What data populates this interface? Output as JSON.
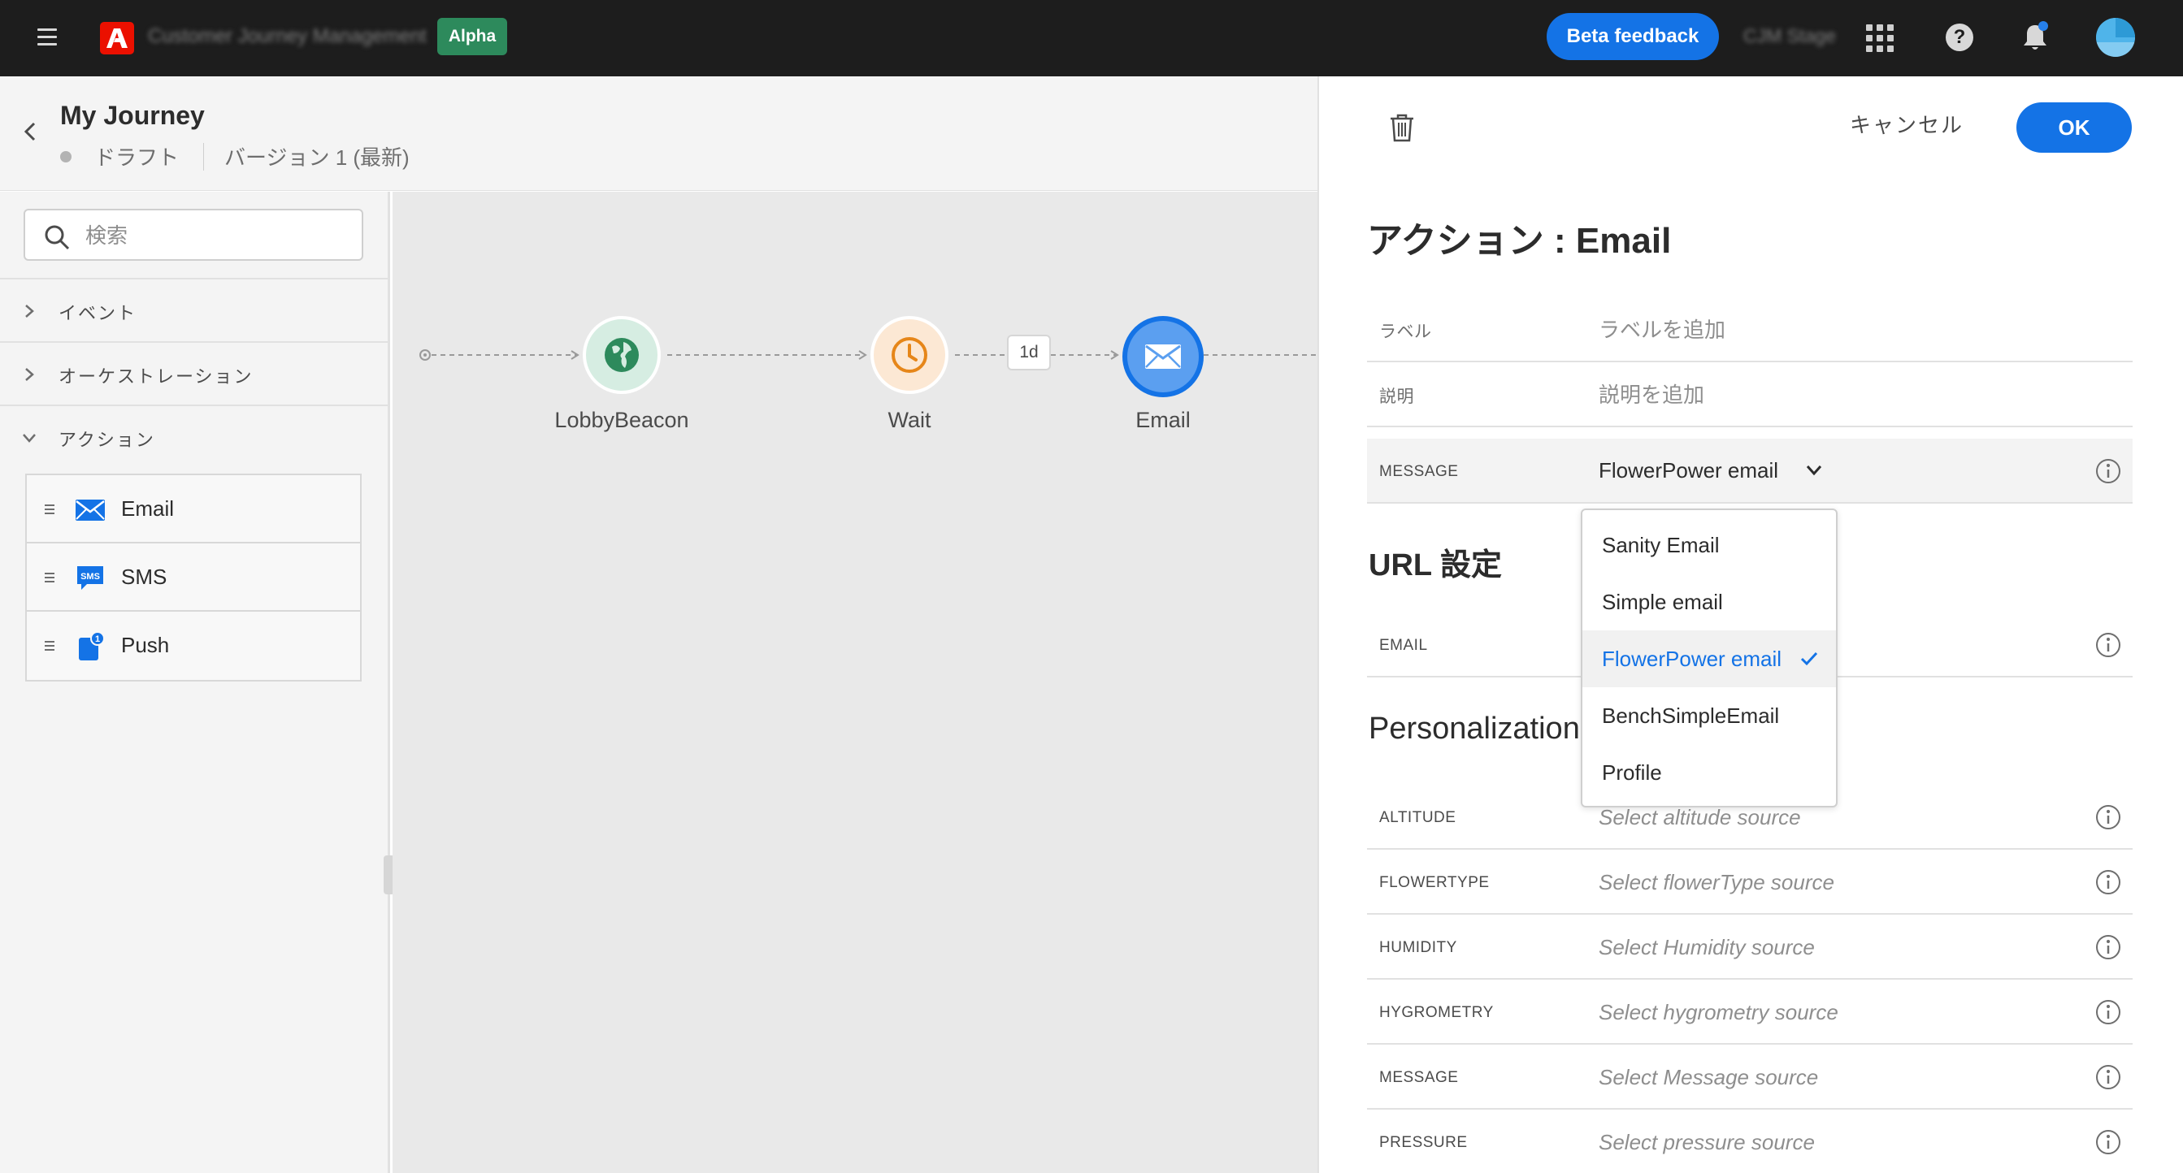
{
  "topbar": {
    "app_name": "Customer Journey Management",
    "alpha_badge": "Alpha",
    "beta_feedback": "Beta feedback",
    "org_name": "CJM Stage",
    "help_glyph": "?",
    "icons": [
      "menu-icon",
      "adobe-logo",
      "apps-grid-icon",
      "help-icon",
      "bell-icon",
      "avatar"
    ],
    "brand_color": "#eb1000",
    "accent_color": "#1473e6"
  },
  "journey": {
    "title": "My Journey",
    "status": "ドラフト",
    "version": "バージョン 1 (最新)"
  },
  "palette": {
    "search_placeholder": "検索",
    "categories": [
      {
        "label": "イベント",
        "expanded": false
      },
      {
        "label": "オーケストレーション",
        "expanded": false
      },
      {
        "label": "アクション",
        "expanded": true
      }
    ],
    "actions": [
      {
        "label": "Email",
        "icon": "email-icon"
      },
      {
        "label": "SMS",
        "icon": "sms-icon",
        "icon_text": "SMS"
      },
      {
        "label": "Push",
        "icon": "push-icon",
        "icon_text": "1"
      }
    ]
  },
  "canvas": {
    "nodes": [
      {
        "label": "LobbyBeacon",
        "icon": "globe-icon",
        "color": "#2d8a5c"
      },
      {
        "label": "Wait",
        "icon": "clock-icon",
        "color": "#e68619"
      },
      {
        "label": "Email",
        "icon": "email-icon",
        "color": "#1473e6"
      }
    ],
    "wait_duration": "1d"
  },
  "panel": {
    "cancel_label": "キャンセル",
    "ok_label": "OK",
    "title": "アクション : Email",
    "label_field": {
      "label": "ラベル",
      "placeholder": "ラベルを追加"
    },
    "description_field": {
      "label": "説明",
      "placeholder": "説明を追加"
    },
    "message_field": {
      "label": "MESSAGE",
      "value": "FlowerPower email"
    },
    "url_section_title": "URL 設定",
    "email_field": {
      "label": "EMAIL"
    },
    "personalization_title": "Personalization D",
    "personalization_fields": [
      {
        "label": "ALTITUDE",
        "placeholder": "Select altitude source"
      },
      {
        "label": "FLOWERTYPE",
        "placeholder": "Select flowerType source"
      },
      {
        "label": "HUMIDITY",
        "placeholder": "Select Humidity source"
      },
      {
        "label": "HYGROMETRY",
        "placeholder": "Select hygrometry source"
      },
      {
        "label": "MESSAGE",
        "placeholder": "Select Message source"
      },
      {
        "label": "PRESSURE",
        "placeholder": "Select pressure source"
      }
    ],
    "dropdown_options": [
      {
        "label": "Sanity Email",
        "selected": false
      },
      {
        "label": "Simple email",
        "selected": false
      },
      {
        "label": "FlowerPower email",
        "selected": true
      },
      {
        "label": "BenchSimpleEmail",
        "selected": false
      },
      {
        "label": "Profile",
        "selected": false
      }
    ]
  }
}
